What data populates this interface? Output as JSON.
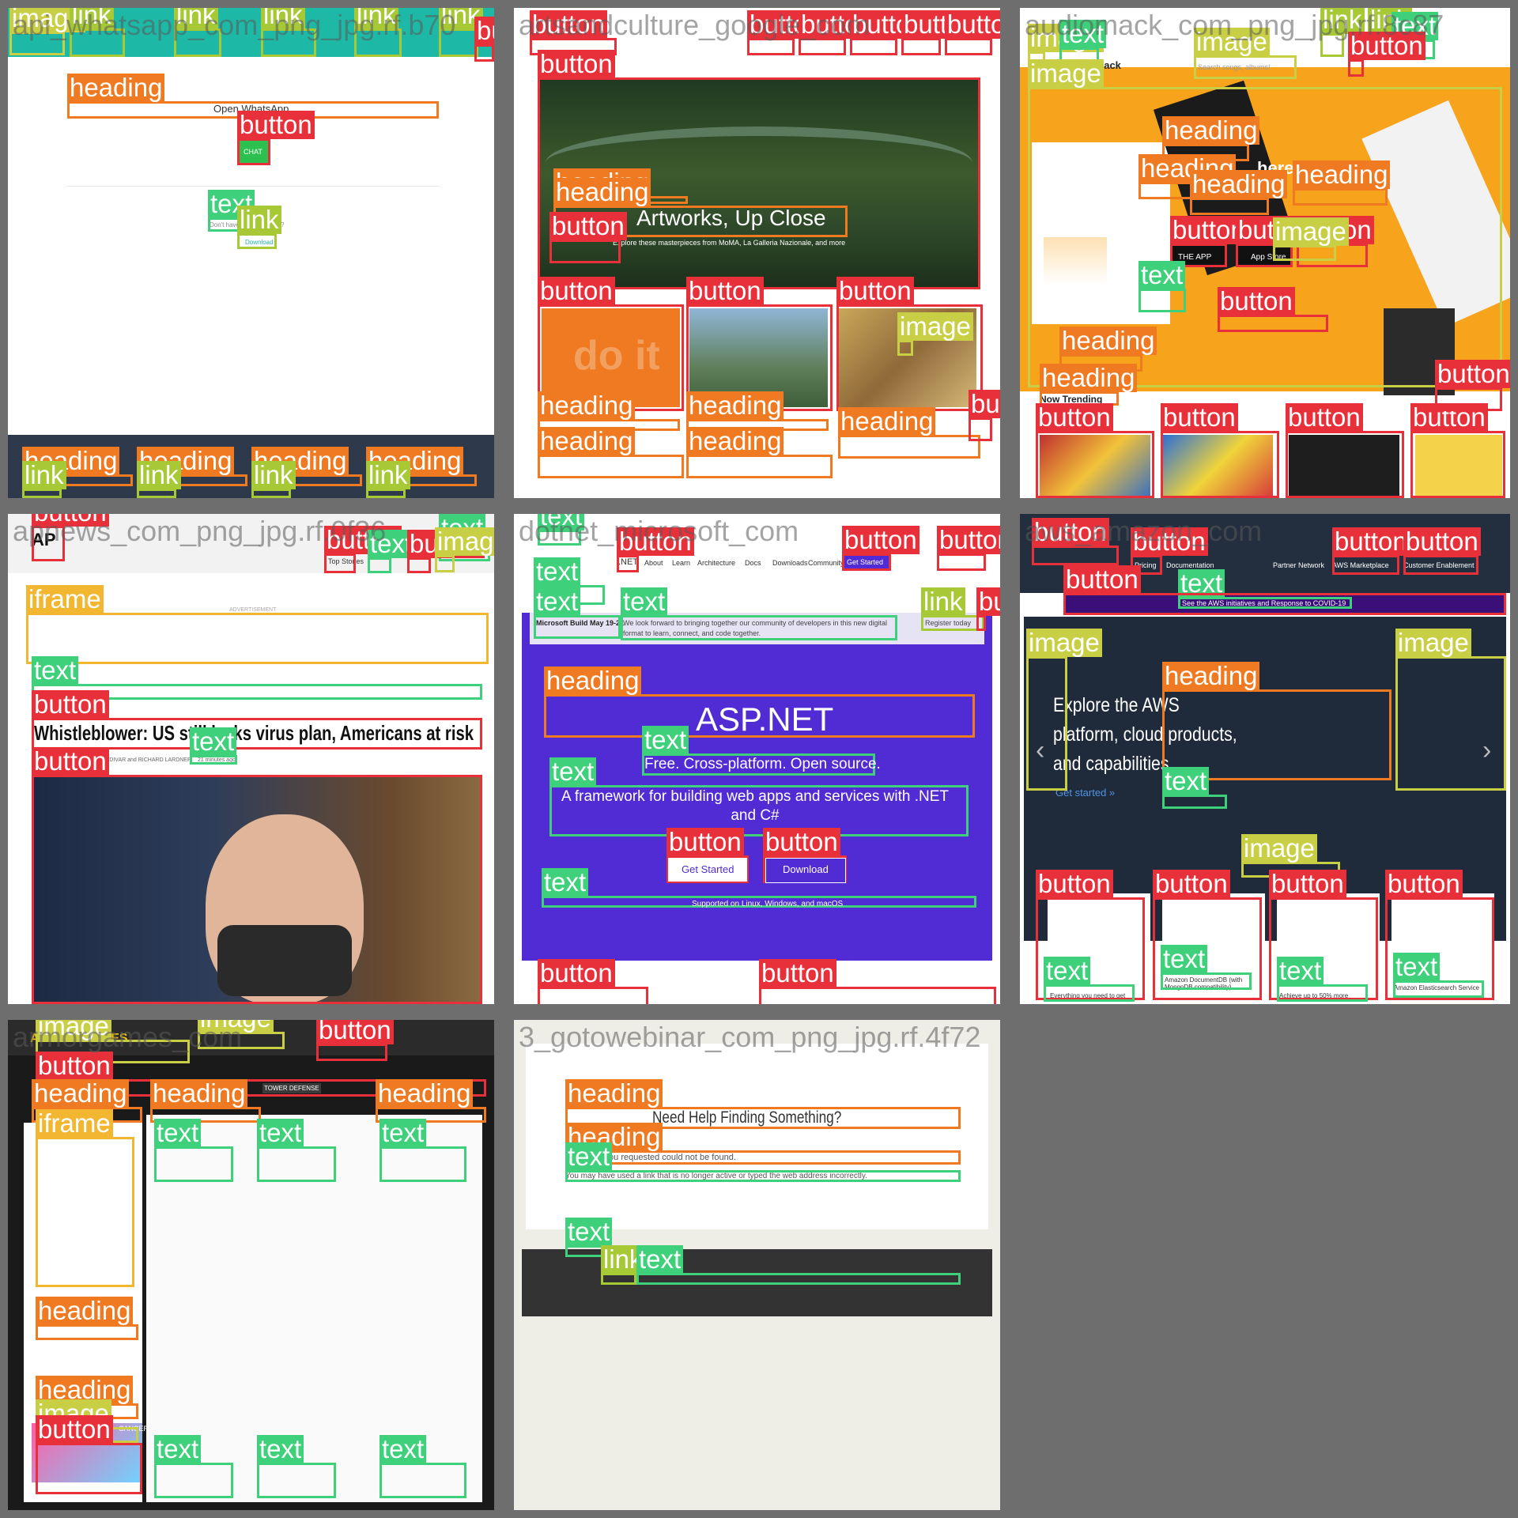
{
  "palette": {
    "button": "#e8303a",
    "heading": "#f07a22",
    "text": "#3ed07a",
    "link": "#a6c935",
    "image": "#c9cf45",
    "iframe": "#f2b630"
  },
  "tiles": [
    {
      "caption": "api_whatsapp_com_png_jpg.rf.b70",
      "bg": "#ffffff",
      "header_color": "#1eb9a6",
      "footer_color": "#2e3a4b",
      "ui_texts": [
        {
          "text": "Open WhatsApp",
          "size": 13,
          "color": "#333333"
        },
        {
          "text": "CHAT",
          "size": 9,
          "color": "#ffffff"
        },
        {
          "text": "Don't have WhatsApp yet?",
          "size": 8,
          "color": "#888888"
        },
        {
          "text": "Download",
          "size": 8,
          "color": "#1eb9a6"
        }
      ],
      "boxes": [
        {
          "type": "image",
          "label": "image"
        },
        {
          "type": "link",
          "label": "link"
        },
        {
          "type": "link",
          "label": "link"
        },
        {
          "type": "link",
          "label": "link"
        },
        {
          "type": "link",
          "label": "link"
        },
        {
          "type": "link",
          "label": "link"
        },
        {
          "type": "button",
          "label": "button"
        },
        {
          "type": "heading",
          "label": "heading"
        },
        {
          "type": "button",
          "label": "button"
        },
        {
          "type": "text",
          "label": "text"
        },
        {
          "type": "link",
          "label": "link"
        },
        {
          "type": "heading",
          "label": "heading"
        },
        {
          "type": "heading",
          "label": "heading"
        },
        {
          "type": "heading",
          "label": "heading"
        },
        {
          "type": "heading",
          "label": "heading"
        },
        {
          "type": "link",
          "label": "link"
        },
        {
          "type": "link",
          "label": "link"
        },
        {
          "type": "link",
          "label": "link"
        },
        {
          "type": "link",
          "label": "link"
        }
      ]
    },
    {
      "caption": "artsandculture_google_com",
      "bg": "#ffffff",
      "ui_texts": [
        {
          "text": "Artworks, Up Close",
          "size": 28,
          "color": "#ffffff"
        },
        {
          "text": "Explore these masterpieces from MoMA, La Galleria Nazionale, and more",
          "size": 9,
          "color": "#ffffff"
        },
        {
          "text": "do it",
          "size": 52,
          "color": "#f2a060"
        }
      ],
      "boxes": [
        {
          "type": "button",
          "label": "button"
        },
        {
          "type": "button",
          "label": "button"
        },
        {
          "type": "button",
          "label": "button"
        },
        {
          "type": "button",
          "label": "button"
        },
        {
          "type": "button",
          "label": "button"
        },
        {
          "type": "button",
          "label": "button"
        },
        {
          "type": "button",
          "label": "button"
        },
        {
          "type": "heading",
          "label": "heading"
        },
        {
          "type": "heading",
          "label": "heading"
        },
        {
          "type": "button",
          "label": "button"
        },
        {
          "type": "button",
          "label": "button"
        },
        {
          "type": "button",
          "label": "button"
        },
        {
          "type": "button",
          "label": "button"
        },
        {
          "type": "image",
          "label": "image"
        },
        {
          "type": "heading",
          "label": "heading"
        },
        {
          "type": "heading",
          "label": "heading"
        },
        {
          "type": "heading",
          "label": "heading"
        },
        {
          "type": "heading",
          "label": "heading"
        },
        {
          "type": "heading",
          "label": "heading"
        },
        {
          "type": "button",
          "label": "button"
        }
      ]
    },
    {
      "caption": "audiomack_com_png_jpg.rf.8c87",
      "bg": "#ffffff",
      "header_color": "#ffffff",
      "ui_texts": [
        {
          "text": "audiomack",
          "size": 13,
          "color": "#222222"
        },
        {
          "text": "Search songs, albums!",
          "size": 9,
          "color": "#999999"
        },
        {
          "text": "Now Trending",
          "size": 12,
          "color": "#222222"
        },
        {
          "text": "here to",
          "size": 22,
          "color": "#ffffff"
        },
        {
          "text": "THE APP",
          "size": 10,
          "color": "#ffffff"
        },
        {
          "text": "App Store",
          "size": 10,
          "color": "#ffffff"
        }
      ],
      "boxes": [
        {
          "type": "image",
          "label": "image"
        },
        {
          "type": "text",
          "label": "text"
        },
        {
          "type": "image",
          "label": "image"
        },
        {
          "type": "link",
          "label": "link"
        },
        {
          "type": "link",
          "label": "link"
        },
        {
          "type": "text",
          "label": "text"
        },
        {
          "type": "image",
          "label": "image"
        },
        {
          "type": "button",
          "label": "button"
        },
        {
          "type": "heading",
          "label": "heading"
        },
        {
          "type": "heading",
          "label": "heading"
        },
        {
          "type": "heading",
          "label": "heading"
        },
        {
          "type": "heading",
          "label": "heading"
        },
        {
          "type": "heading",
          "label": "heading"
        },
        {
          "type": "button",
          "label": "button"
        },
        {
          "type": "button",
          "label": "button"
        },
        {
          "type": "button",
          "label": "button"
        },
        {
          "type": "image",
          "label": "image"
        },
        {
          "type": "text",
          "label": "text"
        },
        {
          "type": "button",
          "label": "button"
        },
        {
          "type": "heading",
          "label": "heading"
        },
        {
          "type": "button",
          "label": "button"
        },
        {
          "type": "button",
          "label": "button"
        },
        {
          "type": "button",
          "label": "button"
        },
        {
          "type": "button",
          "label": "button"
        },
        {
          "type": "button",
          "label": "button"
        }
      ]
    },
    {
      "caption": "apnews_com_png_jpg.rf.0f36",
      "bg": "#ffffff",
      "ui_texts": [
        {
          "text": "AP",
          "size": 22,
          "color": "#111111"
        },
        {
          "text": "Top Stories",
          "size": 9,
          "color": "#333333"
        },
        {
          "text": "ADVERTISEMENT",
          "size": 7,
          "color": "#aaaaaa"
        },
        {
          "text": "Whistleblower: US still lacks virus plan, Americans at risk",
          "size": 26,
          "color": "#111111"
        },
        {
          "text": "By RICARDO ALONSO-ZALDIVAR and RICHARD LARDNER",
          "size": 7,
          "color": "#666666"
        },
        {
          "text": "21 minutes ago",
          "size": 7,
          "color": "#666666"
        }
      ],
      "boxes": [
        {
          "type": "button",
          "label": "button"
        },
        {
          "type": "text",
          "label": "text"
        },
        {
          "type": "button",
          "label": "button"
        },
        {
          "type": "text",
          "label": "text"
        },
        {
          "type": "button",
          "label": "button"
        },
        {
          "type": "image",
          "label": "image"
        },
        {
          "type": "iframe",
          "label": "iframe"
        },
        {
          "type": "text",
          "label": "text"
        },
        {
          "type": "button",
          "label": "button"
        },
        {
          "type": "text",
          "label": "text"
        },
        {
          "type": "button",
          "label": "button"
        }
      ]
    },
    {
      "caption": "dotnet_microsoft_com",
      "bg": "#ffffff",
      "ui_texts": [
        {
          "text": ".NET",
          "size": 11,
          "color": "#333333"
        },
        {
          "text": "About",
          "size": 9,
          "color": "#333333"
        },
        {
          "text": "Learn",
          "size": 9,
          "color": "#333333"
        },
        {
          "text": "Architecture",
          "size": 9,
          "color": "#333333"
        },
        {
          "text": "Docs",
          "size": 9,
          "color": "#333333"
        },
        {
          "text": "Downloads",
          "size": 9,
          "color": "#333333"
        },
        {
          "text": "Community",
          "size": 9,
          "color": "#333333"
        },
        {
          "text": "Get Started",
          "size": 9,
          "color": "#ffffff"
        },
        {
          "text": "Microsoft Build May 19-21",
          "size": 9,
          "color": "#222222"
        },
        {
          "text": "We look forward to bringing together our community of developers in this new digital format to learn, connect, and code together.",
          "size": 9,
          "color": "#444444"
        },
        {
          "text": "Register today",
          "size": 9,
          "color": "#444444"
        },
        {
          "text": "ASP.NET",
          "size": 42,
          "color": "#ffffff"
        },
        {
          "text": "Free. Cross-platform. Open source.",
          "size": 19,
          "color": "#ffffff"
        },
        {
          "text": "A framework for building web apps and services with .NET and C#",
          "size": 19,
          "color": "#ffffff"
        },
        {
          "text": "Get Started",
          "size": 13,
          "color": "#512bd4"
        },
        {
          "text": "Download",
          "size": 13,
          "color": "#ffffff"
        },
        {
          "text": "Supported on Linux, Windows, and macOS",
          "size": 10,
          "color": "#ffffff"
        }
      ],
      "boxes": [
        {
          "type": "text",
          "label": "text"
        },
        {
          "type": "button",
          "label": "button"
        },
        {
          "type": "button",
          "label": "button"
        },
        {
          "type": "button",
          "label": "button"
        },
        {
          "type": "text",
          "label": "text"
        },
        {
          "type": "text",
          "label": "text"
        },
        {
          "type": "text",
          "label": "text"
        },
        {
          "type": "link",
          "label": "link"
        },
        {
          "type": "button",
          "label": "button"
        },
        {
          "type": "heading",
          "label": "heading"
        },
        {
          "type": "text",
          "label": "text"
        },
        {
          "type": "text",
          "label": "text"
        },
        {
          "type": "button",
          "label": "button"
        },
        {
          "type": "button",
          "label": "button"
        },
        {
          "type": "text",
          "label": "text"
        },
        {
          "type": "button",
          "label": "button"
        },
        {
          "type": "button",
          "label": "button"
        }
      ]
    },
    {
      "caption": "aws_amazon_com",
      "bg": "#232f3e",
      "ui_texts": [
        {
          "text": "Pricing",
          "size": 9,
          "color": "#ffffff"
        },
        {
          "text": "Documentation",
          "size": 9,
          "color": "#ffffff"
        },
        {
          "text": "Partner Network",
          "size": 9,
          "color": "#ffffff"
        },
        {
          "text": "AWS Marketplace",
          "size": 9,
          "color": "#ffffff"
        },
        {
          "text": "Customer Enablement",
          "size": 9,
          "color": "#ffffff"
        },
        {
          "text": "See the AWS initiatives and Response to COVID-19",
          "size": 9,
          "color": "#ffffff"
        },
        {
          "text": "Explore the AWS",
          "size": 25,
          "color": "#ffffff"
        },
        {
          "text": "platform, cloud products,",
          "size": 25,
          "color": "#ffffff"
        },
        {
          "text": "and capabilities",
          "size": 25,
          "color": "#ffffff"
        },
        {
          "text": "Get started »",
          "size": 13,
          "color": "#4f95e6"
        },
        {
          "text": "Everything you need to get",
          "size": 8,
          "color": "#333333"
        },
        {
          "text": "Amazon DocumentDB (with MongoDB compatibility)",
          "size": 8,
          "color": "#333333"
        },
        {
          "text": "Achieve up to 50% more",
          "size": 8,
          "color": "#333333"
        },
        {
          "text": "Amazon Elasticsearch Service",
          "size": 8,
          "color": "#333333"
        }
      ],
      "boxes": [
        {
          "type": "button",
          "label": "button"
        },
        {
          "type": "button",
          "label": "button"
        },
        {
          "type": "button",
          "label": "button"
        },
        {
          "type": "button",
          "label": "button"
        },
        {
          "type": "text",
          "label": "text"
        },
        {
          "type": "button",
          "label": "button"
        },
        {
          "type": "image",
          "label": "image"
        },
        {
          "type": "image",
          "label": "image"
        },
        {
          "type": "heading",
          "label": "heading"
        },
        {
          "type": "text",
          "label": "text"
        },
        {
          "type": "image",
          "label": "image"
        },
        {
          "type": "button",
          "label": "button"
        },
        {
          "type": "button",
          "label": "button"
        },
        {
          "type": "button",
          "label": "button"
        },
        {
          "type": "button",
          "label": "button"
        },
        {
          "type": "text",
          "label": "text"
        },
        {
          "type": "text",
          "label": "text"
        },
        {
          "type": "text",
          "label": "text"
        },
        {
          "type": "text",
          "label": "text"
        }
      ]
    },
    {
      "caption": "armorgames_com",
      "bg": "#1a1a1a",
      "ui_texts": [
        {
          "text": "ARMOR GAMES",
          "size": 16,
          "color": "#f4c20d"
        },
        {
          "text": "TOWER DEFENSE",
          "size": 8,
          "color": "#ffffff"
        },
        {
          "text": "CANCER",
          "size": 9,
          "color": "#ffffff"
        },
        {
          "text": "Cancer is available now, for Steam and",
          "size": 7,
          "color": "#ffffff"
        }
      ],
      "boxes": [
        {
          "type": "image",
          "label": "image"
        },
        {
          "type": "image",
          "label": "image"
        },
        {
          "type": "button",
          "label": "button"
        },
        {
          "type": "button",
          "label": "button"
        },
        {
          "type": "heading",
          "label": "heading"
        },
        {
          "type": "heading",
          "label": "heading"
        },
        {
          "type": "heading",
          "label": "heading"
        },
        {
          "type": "iframe",
          "label": "iframe"
        },
        {
          "type": "heading",
          "label": "heading"
        },
        {
          "type": "heading",
          "label": "heading"
        },
        {
          "type": "image",
          "label": "image"
        },
        {
          "type": "button",
          "label": "button"
        },
        {
          "type": "text",
          "label": "text"
        },
        {
          "type": "text",
          "label": "text"
        },
        {
          "type": "text",
          "label": "text"
        },
        {
          "type": "text",
          "label": "text"
        },
        {
          "type": "text",
          "label": "text"
        },
        {
          "type": "text",
          "label": "text"
        }
      ]
    },
    {
      "caption": "3_gotowebinar_com_png_jpg.rf.4f72",
      "bg": "#eeede6",
      "ui_texts": [
        {
          "text": "Need Help Finding Something?",
          "size": 21,
          "color": "#333333"
        },
        {
          "text": "The page you requested could not be found.",
          "size": 11,
          "color": "#555555"
        },
        {
          "text": "You may have used a link that is no longer active or typed the web address incorrectly.",
          "size": 10,
          "color": "#555555"
        }
      ],
      "boxes": [
        {
          "type": "heading",
          "label": "heading"
        },
        {
          "type": "heading",
          "label": "heading"
        },
        {
          "type": "text",
          "label": "text"
        },
        {
          "type": "text",
          "label": "text"
        },
        {
          "type": "link",
          "label": "link"
        },
        {
          "type": "text",
          "label": "text"
        }
      ]
    }
  ]
}
